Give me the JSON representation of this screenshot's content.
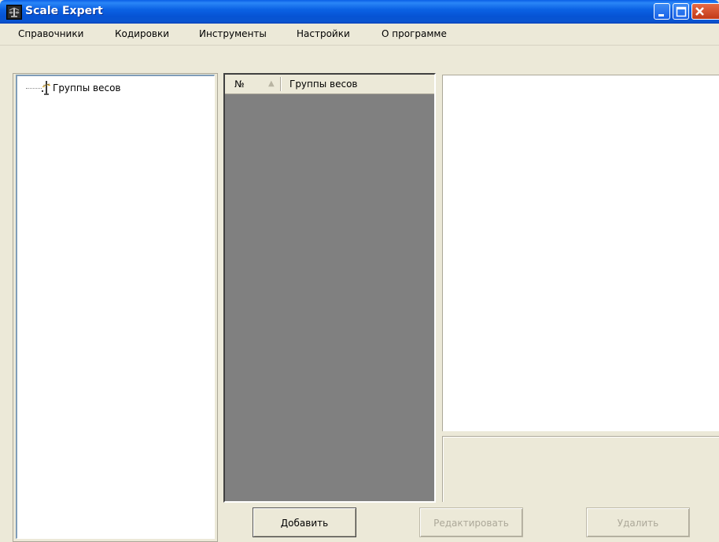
{
  "window": {
    "title": "Scale Expert"
  },
  "menu": {
    "items": [
      {
        "label": "Справочники"
      },
      {
        "label": "Кодировки"
      },
      {
        "label": "Инструменты"
      },
      {
        "label": "Настройки"
      },
      {
        "label": "О программе"
      }
    ]
  },
  "tree": {
    "root_label": "Группы весов",
    "root_icon": "scale-icon"
  },
  "list": {
    "columns": [
      {
        "label": "№"
      },
      {
        "label": "Группы весов"
      }
    ],
    "sort_indicator": "▲",
    "rows": []
  },
  "buttons": {
    "add_label": "Добавить",
    "edit_label": "Редактировать",
    "delete_label": "Удалить"
  },
  "colors": {
    "titlebar": "#0A5FE6",
    "window_bg": "#ECE9D8",
    "list_bg": "#808080",
    "disabled_text": "#ACA899"
  }
}
